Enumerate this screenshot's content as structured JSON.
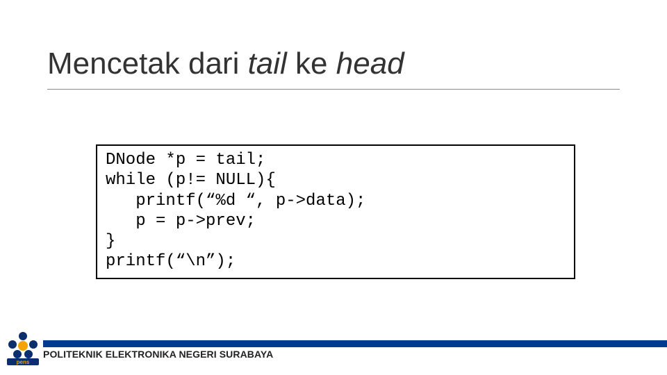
{
  "title": {
    "pre": "Mencetak dari ",
    "italic1": "tail",
    "mid": " ke  ",
    "italic2": "head"
  },
  "code": {
    "l1": "DNode *p = tail;",
    "l2": "while (p!= NULL){",
    "l3": "   printf(“%d “, p->data);",
    "l4": "   p = p->prev;",
    "l5": "}",
    "l6": "printf(“\\n”);"
  },
  "footer": "POLITEKNIK ELEKTRONIKA NEGERI SURABAYA",
  "logo_alt": "PENS"
}
